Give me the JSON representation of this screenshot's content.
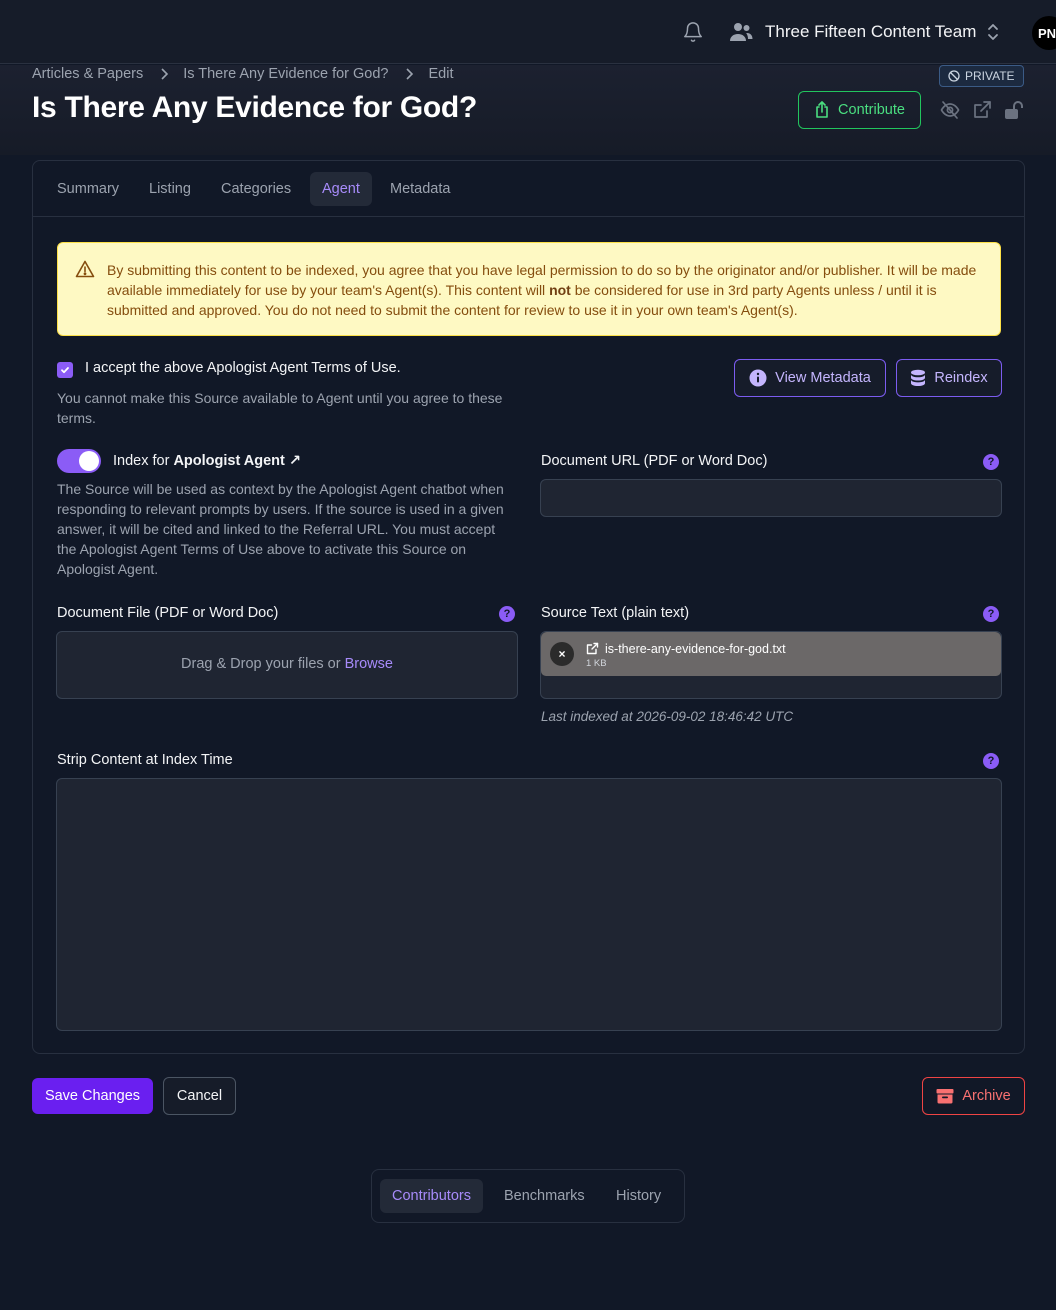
{
  "header": {
    "team_name": "Three Fifteen Content Team",
    "avatar_initials": "PN"
  },
  "breadcrumb": {
    "items": [
      "Articles & Papers",
      "Is There Any Evidence for God?",
      "Edit"
    ]
  },
  "page": {
    "title": "Is There Any Evidence for God?",
    "visibility_badge": "PRIVATE",
    "contribute_label": "Contribute"
  },
  "tabs": [
    "Summary",
    "Listing",
    "Categories",
    "Agent",
    "Metadata"
  ],
  "active_tab": "Agent",
  "warning": {
    "text_before": "By submitting this content to be indexed, you agree that you have legal permission to do so by the originator and/or publisher. It will be made available immediately for use by your team's Agent(s). This content will ",
    "text_bold": "not",
    "text_after": " be considered for use in 3rd party Agents unless / until it is submitted and approved. You do not need to submit the content for review to use it in your own team's Agent(s)."
  },
  "terms": {
    "checked": true,
    "label": "I accept the above Apologist Agent Terms of Use.",
    "help": "You cannot make this Source available to Agent until you agree to these terms."
  },
  "actions": {
    "view_metadata": "View Metadata",
    "reindex": "Reindex"
  },
  "index_toggle": {
    "enabled": true,
    "label_prefix": "Index for ",
    "label_bold": "Apologist Agent ↗",
    "help": "The Source will be used as context by the Apologist Agent chatbot when responding to relevant prompts by users. If the source is used in a given answer, it will be cited and linked to the Referral URL. You must accept the Apologist Agent Terms of Use above to activate this Source on Apologist Agent."
  },
  "document_url": {
    "label": "Document URL (PDF or Word Doc)",
    "value": ""
  },
  "document_file": {
    "label": "Document File (PDF or Word Doc)",
    "drop_text": "Drag & Drop your files or ",
    "browse_text": "Browse"
  },
  "source_text": {
    "label": "Source Text (plain text)",
    "file_name": "is-there-any-evidence-for-god.txt",
    "file_size": "1 KB",
    "last_indexed": "Last indexed at 2026-09-02 18:46:42 UTC"
  },
  "strip_content": {
    "label": "Strip Content at Index Time",
    "value": ""
  },
  "help_glyph": "?",
  "remove_glyph": "×",
  "form_buttons": {
    "save": "Save Changes",
    "cancel": "Cancel",
    "archive": "Archive"
  },
  "bottom_tabs": [
    "Contributors",
    "Benchmarks",
    "History"
  ],
  "bottom_active_tab": "Contributors",
  "colors": {
    "accent": "#8b5cf6",
    "success": "#22c55e",
    "danger": "#ef4444",
    "warning_bg": "#fef9c3",
    "background": "#111827"
  }
}
